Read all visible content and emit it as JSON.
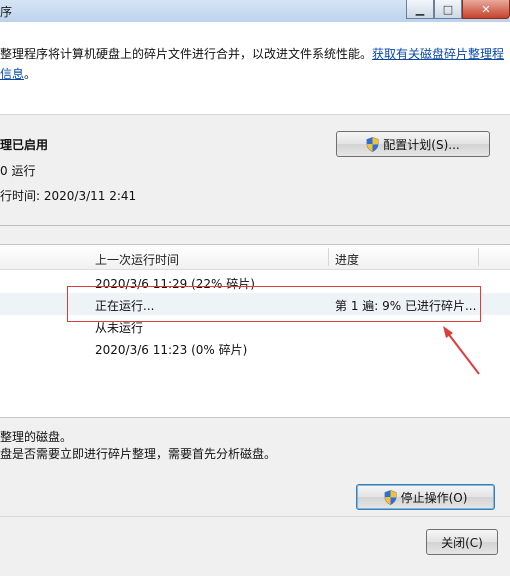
{
  "window": {
    "title": "序",
    "controls": [
      "minimize",
      "maximize",
      "close"
    ]
  },
  "intro": {
    "text": "整理程序将计算机硬盘上的碎片文件进行合并，以改进文件系统性能。",
    "link_line1": "获取有关磁盘碎片整理程",
    "link_line2": "信息",
    "link_suffix": "。"
  },
  "schedule": {
    "status": "理已启用",
    "line2": "0 运行",
    "line3": "行时间: 2020/3/11 2:41",
    "button_label": "配置计划(S)..."
  },
  "table": {
    "headers": [
      "上一次运行时间",
      "进度"
    ],
    "rows": [
      {
        "last_run": "2020/3/6 11:29 (22% 碎片)",
        "progress": ""
      },
      {
        "last_run": "正在运行...",
        "progress": "第 1 遍: 9% 已进行碎片..."
      },
      {
        "last_run": "从未运行",
        "progress": ""
      },
      {
        "last_run": "2020/3/6 11:23 (0% 碎片)",
        "progress": ""
      }
    ]
  },
  "bottom": {
    "line1": "整理的磁盘。",
    "line2": "盘是否需要立即进行碎片整理，需要首先分析磁盘。"
  },
  "buttons": {
    "stop_label": "停止操作(O)",
    "close_label": "关闭(C)"
  },
  "colors": {
    "highlight": "#e23b3b",
    "link": "#0a49a8"
  }
}
